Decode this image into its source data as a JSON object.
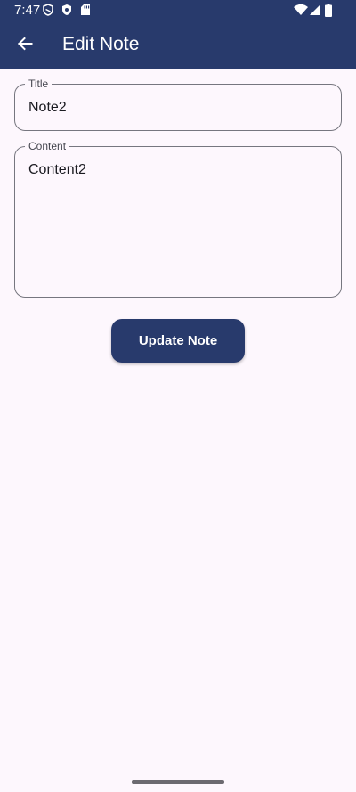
{
  "status_bar": {
    "time": "7:47",
    "icons": [
      "shield-outline-icon",
      "shield-filled-icon",
      "sd-card-icon",
      "wifi-icon",
      "signal-icon",
      "battery-icon"
    ]
  },
  "app_bar": {
    "title": "Edit Note",
    "back_icon": "arrow-left-icon"
  },
  "form": {
    "title_field": {
      "label": "Title",
      "value": "Note2"
    },
    "content_field": {
      "label": "Content",
      "value": "Content2"
    },
    "update_button": {
      "label": "Update Note"
    }
  },
  "colors": {
    "primary": "#283a6c",
    "background": "#fdf7fd",
    "outline": "#76767f",
    "on_primary": "#ffffff"
  }
}
